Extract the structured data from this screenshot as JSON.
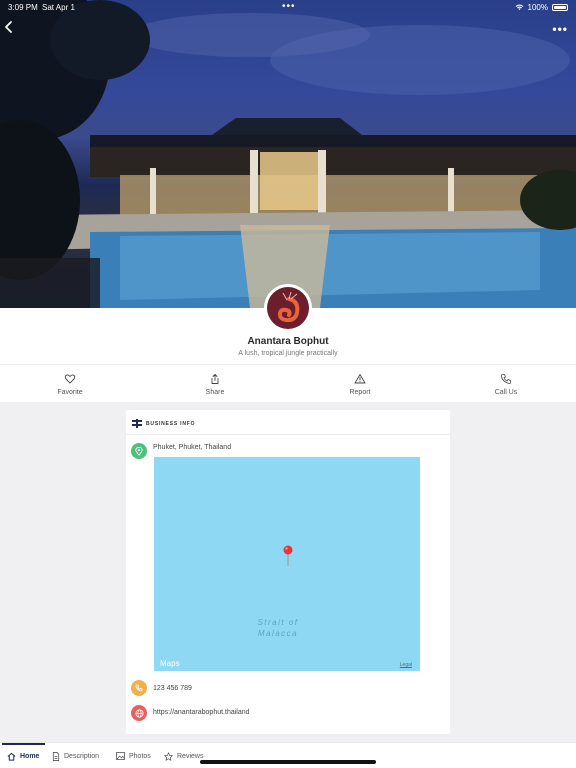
{
  "status_bar": {
    "time": "3:09 PM",
    "date": "Sat Apr 1",
    "battery": "100%"
  },
  "business": {
    "name": "Anantara Bophut",
    "tagline": "A lush, tropical jungle practically"
  },
  "actions": [
    {
      "label": "Favorite",
      "icon": "heart-icon"
    },
    {
      "label": "Share",
      "icon": "share-icon"
    },
    {
      "label": "Report",
      "icon": "warning-icon"
    },
    {
      "label": "Call Us",
      "icon": "phone-icon"
    }
  ],
  "card": {
    "title": "BUSINESS INFO",
    "location": "Phuket, Phuket, Thailand",
    "phone": "123 456 789",
    "website": "https://anantarabophut.thailand"
  },
  "map": {
    "label": "Strait of Malacca",
    "logo": "Maps",
    "legal": "Legal"
  },
  "tabs": [
    {
      "label": "Home",
      "icon": "home-icon",
      "active": true
    },
    {
      "label": "Description",
      "icon": "document-icon",
      "active": false
    },
    {
      "label": "Photos",
      "icon": "photo-icon",
      "active": false
    },
    {
      "label": "Reviews",
      "icon": "star-icon",
      "active": false
    }
  ],
  "colors": {
    "accent": "#1f2a5a",
    "location_icon_bg": "#4cc17a",
    "phone_icon_bg": "#f0b04a",
    "web_icon_bg": "#e86060",
    "avatar_bg": "#6b1e2c",
    "map_water": "#8fd8f3"
  }
}
